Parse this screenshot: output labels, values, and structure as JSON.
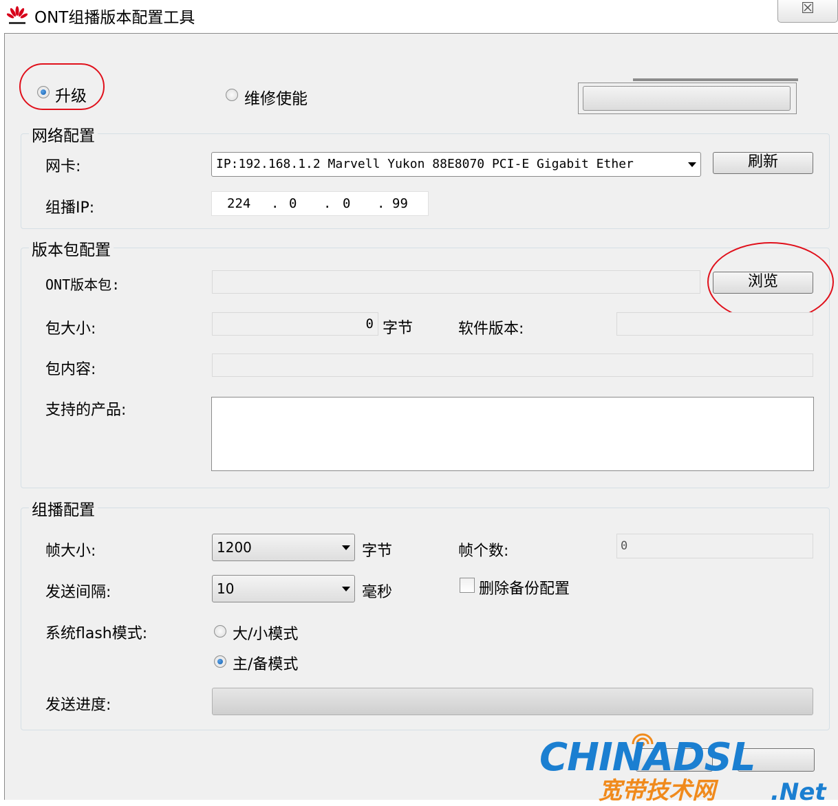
{
  "window": {
    "title": "ONT组播版本配置工具",
    "close_glyph": "☒"
  },
  "mode": {
    "upgrade_label": "升级",
    "repair_label": "维修使能",
    "selected": "upgrade"
  },
  "network": {
    "group_title": "网络配置",
    "nic_label": "网卡:",
    "nic_value": "IP:192.168.1.2 Marvell Yukon 88E8070 PCI-E Gigabit Ether",
    "refresh_label": "刷新",
    "multicast_ip_label": "组播IP:",
    "ip_octets": [
      "224",
      "0",
      "0",
      "99"
    ]
  },
  "package": {
    "group_title": "版本包配置",
    "ont_package_label": "ONT版本包:",
    "ont_package_value": "",
    "browse_label": "浏览",
    "size_label": "包大小:",
    "size_value": "0",
    "size_unit": "字节",
    "software_version_label": "软件版本:",
    "software_version_value": "",
    "content_label": "包内容:",
    "content_value": "",
    "supported_products_label": "支持的产品:",
    "supported_products_value": ""
  },
  "multicast": {
    "group_title": "组播配置",
    "frame_size_label": "帧大小:",
    "frame_size_value": "1200",
    "frame_size_unit": "字节",
    "frame_count_label": "帧个数:",
    "frame_count_value": "0",
    "send_interval_label": "发送间隔:",
    "send_interval_value": "10",
    "send_interval_unit": "毫秒",
    "delete_backup_label": "删除备份配置",
    "delete_backup_checked": false,
    "flash_mode_label": "系统flash模式:",
    "flash_mode_option1": "大/小模式",
    "flash_mode_option2": "主/备模式",
    "flash_mode_selected": "option2",
    "send_progress_label": "发送进度:",
    "send_progress_value": 0
  },
  "watermark": {
    "text_en": "CHINADSL",
    "text_cn": "宽带技术网",
    "text_net": ".Net"
  },
  "colors": {
    "annotation_red": "#e0101b",
    "watermark_blue": "#1b7fd1",
    "watermark_orange": "#f08a1c"
  }
}
